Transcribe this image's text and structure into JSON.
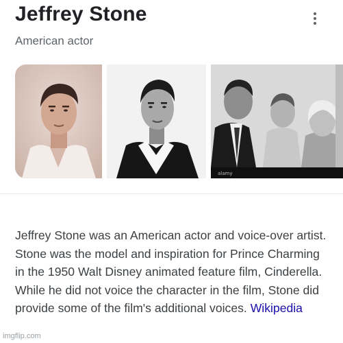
{
  "header": {
    "title": "Jeffrey Stone",
    "subtitle": "American actor"
  },
  "gallery": {
    "images": [
      {
        "description": "sepia portrait of a man in an open-collar shirt"
      },
      {
        "description": "black and white portrait of a man in an open-collar shirt"
      },
      {
        "description": "black and white family photo of a man, woman and boy",
        "watermark": "alamy"
      }
    ]
  },
  "description": {
    "text": "Jeffrey Stone was an American actor and voice-over artist. Stone was the model and inspiration for Prince Charming in the 1950 Walt Disney animated feature film, Cinderella. While he did not voice the character in the film, Stone did provide some of the film's additional voices.",
    "source_link": "Wikipedia"
  },
  "footer": {
    "watermark": "imgflip.com"
  },
  "icons": {
    "more": "more-vert-icon"
  }
}
